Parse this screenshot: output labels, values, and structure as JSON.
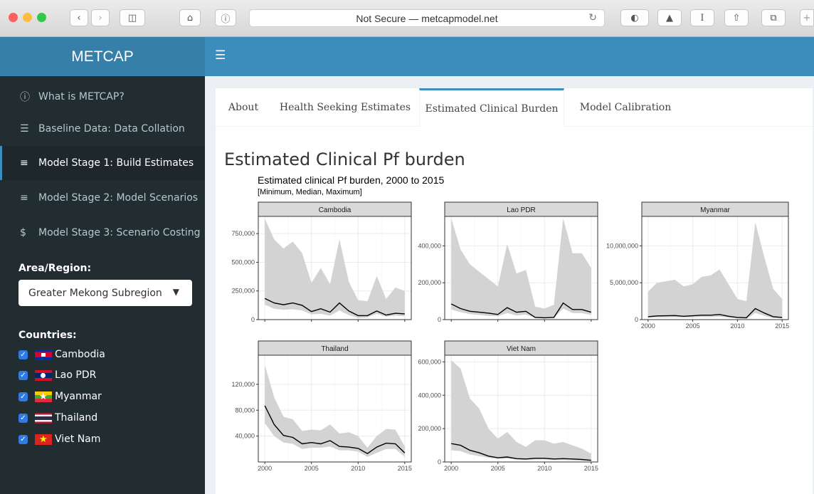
{
  "browser": {
    "url_text": "Not Secure — metcapmodel.net",
    "colors": {
      "close": "#fc605c",
      "minimize": "#fdbc40",
      "zoom": "#34c84a"
    }
  },
  "app": {
    "brand": "METCAP",
    "accent": "#3c8dbc"
  },
  "sidebar": {
    "items": [
      {
        "label": "What is METCAP?",
        "icon": "info-icon"
      },
      {
        "label": "Baseline Data: Data Collation",
        "icon": "database-icon"
      },
      {
        "label": "Model Stage 1: Build Estimates",
        "icon": "sliders-icon"
      },
      {
        "label": "Model Stage 2: Model Scenarios",
        "icon": "sliders-icon"
      },
      {
        "label": "Model Stage 3: Scenario Costing",
        "icon": "dollar-icon"
      }
    ],
    "area_label": "Area/Region:",
    "area_value": "Greater Mekong Subregion",
    "countries_label": "Countries:",
    "countries": [
      "Cambodia",
      "Lao PDR",
      "Myanmar",
      "Thailand",
      "Viet Nam"
    ]
  },
  "tabs": [
    "About",
    "Health Seeking Estimates",
    "Estimated Clinical Burden",
    "Model Calibration"
  ],
  "page": {
    "heading": "Estimated Clinical Pf burden"
  },
  "chart_data": {
    "type": "area",
    "title": "Estimated clinical Pf burden, 2000 to 2015",
    "subtitle": "[Minimum, Median, Maximum]",
    "xlabel": "",
    "ylabel": "",
    "x": [
      2000,
      2001,
      2002,
      2003,
      2004,
      2005,
      2006,
      2007,
      2008,
      2009,
      2010,
      2011,
      2012,
      2013,
      2014,
      2015
    ],
    "x_ticks": [
      "2000",
      "2005",
      "2010",
      "2015"
    ],
    "panels": [
      {
        "name": "Cambodia",
        "ylim": [
          0,
          900000
        ],
        "y_ticks": [
          0,
          250000,
          500000,
          750000
        ],
        "y_tick_labels": [
          "0",
          "250,000",
          "500,000",
          "750,000"
        ],
        "min": [
          130000,
          95000,
          85000,
          90000,
          80000,
          45000,
          50000,
          35000,
          80000,
          40000,
          15000,
          20000,
          50000,
          25000,
          35000,
          30000
        ],
        "median": [
          185000,
          145000,
          130000,
          145000,
          125000,
          70000,
          95000,
          65000,
          145000,
          75000,
          35000,
          35000,
          75000,
          40000,
          55000,
          50000
        ],
        "max": [
          880000,
          700000,
          620000,
          680000,
          580000,
          320000,
          450000,
          310000,
          700000,
          330000,
          170000,
          160000,
          380000,
          180000,
          280000,
          250000
        ]
      },
      {
        "name": "Lao PDR",
        "ylim": [
          0,
          560000
        ],
        "y_ticks": [
          0,
          200000,
          400000
        ],
        "y_tick_labels": [
          "0",
          "200,000",
          "400,000"
        ],
        "min": [
          55000,
          40000,
          30000,
          25000,
          20000,
          18000,
          35000,
          22000,
          28000,
          8000,
          6000,
          8000,
          60000,
          35000,
          35000,
          25000
        ],
        "median": [
          85000,
          60000,
          45000,
          40000,
          35000,
          28000,
          65000,
          40000,
          45000,
          12000,
          10000,
          12000,
          90000,
          55000,
          55000,
          40000
        ],
        "max": [
          550000,
          380000,
          300000,
          260000,
          220000,
          180000,
          410000,
          250000,
          270000,
          70000,
          60000,
          80000,
          550000,
          360000,
          360000,
          280000
        ]
      },
      {
        "name": "Myanmar",
        "ylim": [
          0,
          14000000
        ],
        "y_ticks": [
          0,
          5000000,
          10000000
        ],
        "y_tick_labels": [
          "0",
          "5,000,000",
          "10,000,000"
        ],
        "min": [
          250000,
          300000,
          300000,
          320000,
          280000,
          300000,
          350000,
          350000,
          400000,
          280000,
          150000,
          100000,
          900000,
          500000,
          200000,
          150000
        ],
        "median": [
          400000,
          500000,
          520000,
          550000,
          450000,
          520000,
          600000,
          600000,
          700000,
          450000,
          300000,
          250000,
          1500000,
          900000,
          400000,
          300000
        ],
        "max": [
          3800000,
          5000000,
          5200000,
          5400000,
          4500000,
          4800000,
          5800000,
          6000000,
          6800000,
          4800000,
          2800000,
          2500000,
          13200000,
          8500000,
          4200000,
          2800000
        ]
      },
      {
        "name": "Thailand",
        "ylim": [
          0,
          165000
        ],
        "y_ticks": [
          40000,
          80000,
          120000
        ],
        "y_tick_labels": [
          "40,000",
          "80,000",
          "120,000"
        ],
        "min": [
          60000,
          40000,
          30000,
          28000,
          20000,
          22000,
          22000,
          24000,
          18000,
          18000,
          16000,
          8000,
          14000,
          20000,
          20000,
          8000
        ],
        "median": [
          87000,
          58000,
          41000,
          38000,
          28000,
          30000,
          28000,
          33000,
          24000,
          23000,
          21000,
          13000,
          23000,
          29000,
          28000,
          14000
        ],
        "max": [
          150000,
          100000,
          70000,
          66000,
          48000,
          50000,
          49000,
          58000,
          44000,
          46000,
          40000,
          22000,
          40000,
          51000,
          50000,
          24000
        ]
      },
      {
        "name": "Viet Nam",
        "ylim": [
          0,
          640000
        ],
        "y_ticks": [
          0,
          200000,
          400000,
          600000
        ],
        "y_tick_labels": [
          "0",
          "200,000",
          "400,000",
          "600,000"
        ],
        "min": [
          70000,
          65000,
          45000,
          35000,
          25000,
          18000,
          20000,
          15000,
          12000,
          15000,
          15000,
          12000,
          12000,
          10000,
          8000,
          5000
        ],
        "median": [
          110000,
          100000,
          70000,
          55000,
          35000,
          25000,
          30000,
          20000,
          18000,
          22000,
          22000,
          18000,
          20000,
          18000,
          15000,
          10000
        ],
        "max": [
          610000,
          560000,
          380000,
          320000,
          200000,
          140000,
          180000,
          120000,
          90000,
          130000,
          130000,
          110000,
          120000,
          100000,
          80000,
          50000
        ]
      }
    ]
  }
}
